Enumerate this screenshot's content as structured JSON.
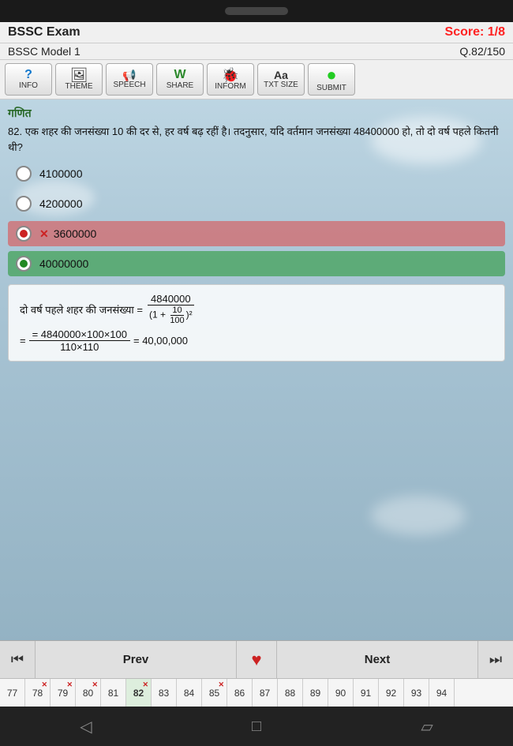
{
  "statusBar": {
    "pill": ""
  },
  "header": {
    "title": "BSSC Exam",
    "score": "Score: 1/8"
  },
  "subHeader": {
    "model": "BSSC Model 1",
    "qnum": "Q.82/150"
  },
  "toolbar": {
    "buttons": [
      {
        "id": "info",
        "icon": "?",
        "label": "INFO"
      },
      {
        "id": "theme",
        "icon": "🖼",
        "label": "THEME"
      },
      {
        "id": "speech",
        "icon": "📢",
        "label": "SPEECH"
      },
      {
        "id": "share",
        "icon": "W",
        "label": "SHARE"
      },
      {
        "id": "inform",
        "icon": "🐞",
        "label": "INFORM"
      },
      {
        "id": "txtsize",
        "icon": "Aa",
        "label": "TXT SIZE"
      },
      {
        "id": "submit",
        "icon": "⬤",
        "label": "SUBMIT"
      }
    ]
  },
  "question": {
    "subject": "गणित",
    "number": "82.",
    "text": " एक शहर की जनसंख्या 10 की दर से, हर वर्ष बढ़ रहीं है। तदनुसार, यदि वर्तमान जनसंख्या 48400000 हो, तो दो वर्ष पहले कितनी थी?"
  },
  "options": [
    {
      "id": "a",
      "value": "4100000",
      "state": "normal"
    },
    {
      "id": "b",
      "value": "4200000",
      "state": "normal"
    },
    {
      "id": "c",
      "value": "3600000",
      "state": "wrong"
    },
    {
      "id": "d",
      "value": "40000000",
      "state": "correct"
    }
  ],
  "solution": {
    "line1": "दो वर्ष पहले शहर की जनसंख्या =",
    "numerator": "4840000",
    "denominator_expr": "(1 + 10/100)²",
    "line2": "= 4840000×100×100",
    "line2b": "110×110",
    "line3": "= 40,00,000"
  },
  "navigation": {
    "prevLabel": "Prev",
    "nextLabel": "Next",
    "heartIcon": "♥",
    "firstIcon": "⏮",
    "lastIcon": "⏭"
  },
  "questionStrip": {
    "numbers": [
      77,
      78,
      79,
      80,
      81,
      82,
      83,
      84,
      85,
      86,
      87,
      88,
      89,
      90,
      91,
      92,
      93,
      94
    ],
    "attempted": [
      77,
      78,
      79,
      80,
      82,
      85
    ],
    "wrong": [
      78,
      79,
      80,
      82,
      85
    ],
    "active": 82
  },
  "androidNav": {
    "back": "◁",
    "home": "□",
    "recent": "▱"
  }
}
